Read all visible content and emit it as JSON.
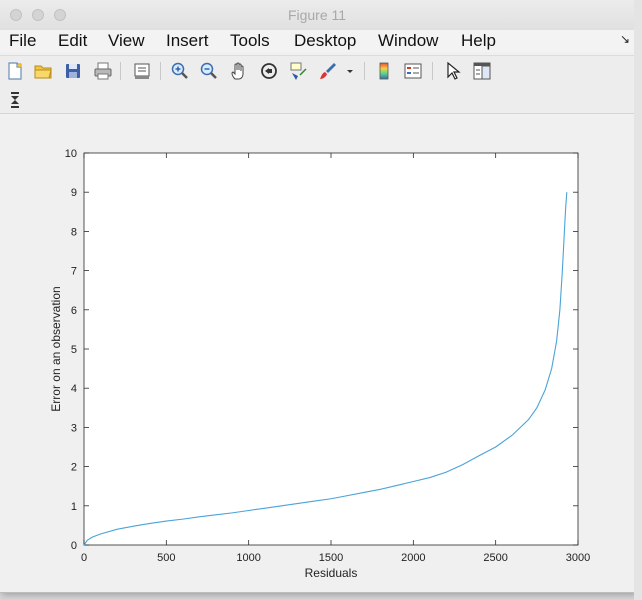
{
  "window": {
    "title": "Figure 11"
  },
  "menu": {
    "items": [
      "File",
      "Edit",
      "View",
      "Insert",
      "Tools",
      "Desktop",
      "Window",
      "Help"
    ],
    "corner": "↘"
  },
  "toolbar": {
    "icons": [
      "new-figure-icon",
      "open-file-icon",
      "save-icon",
      "print-icon",
      "print-preview-icon",
      "zoom-in-icon",
      "zoom-out-icon",
      "pan-hand-icon",
      "rotate-3d-icon",
      "data-cursor-icon",
      "brush-icon",
      "colorbar-icon",
      "legend-icon",
      "pointer-icon",
      "property-editor-icon"
    ]
  },
  "toolbar2": {
    "icons": [
      "dock-figure-icon"
    ]
  },
  "chart_data": {
    "type": "line",
    "xlabel": "Residuals",
    "ylabel": "Error on an observation",
    "xlim": [
      0,
      3000
    ],
    "ylim": [
      0,
      10
    ],
    "xticks": [
      0,
      500,
      1000,
      1500,
      2000,
      2500,
      3000
    ],
    "yticks": [
      0,
      1,
      2,
      3,
      4,
      5,
      6,
      7,
      8,
      9,
      10
    ],
    "grid": false,
    "line_color": "#4aa3d8",
    "series": [
      {
        "x": [
          0,
          20,
          50,
          100,
          200,
          300,
          400,
          500,
          600,
          700,
          800,
          900,
          1000,
          1100,
          1200,
          1300,
          1400,
          1500,
          1600,
          1700,
          1800,
          1900,
          2000,
          2100,
          2200,
          2300,
          2400,
          2500,
          2600,
          2700,
          2750,
          2800,
          2840,
          2870,
          2890,
          2905,
          2915,
          2925,
          2932
        ],
        "y": [
          0,
          0.12,
          0.2,
          0.28,
          0.4,
          0.48,
          0.55,
          0.61,
          0.66,
          0.72,
          0.77,
          0.82,
          0.88,
          0.94,
          1.0,
          1.06,
          1.12,
          1.18,
          1.26,
          1.34,
          1.42,
          1.52,
          1.62,
          1.72,
          1.86,
          2.05,
          2.28,
          2.5,
          2.8,
          3.2,
          3.5,
          3.95,
          4.5,
          5.2,
          6.0,
          7.0,
          7.8,
          8.6,
          9.0
        ]
      }
    ]
  }
}
